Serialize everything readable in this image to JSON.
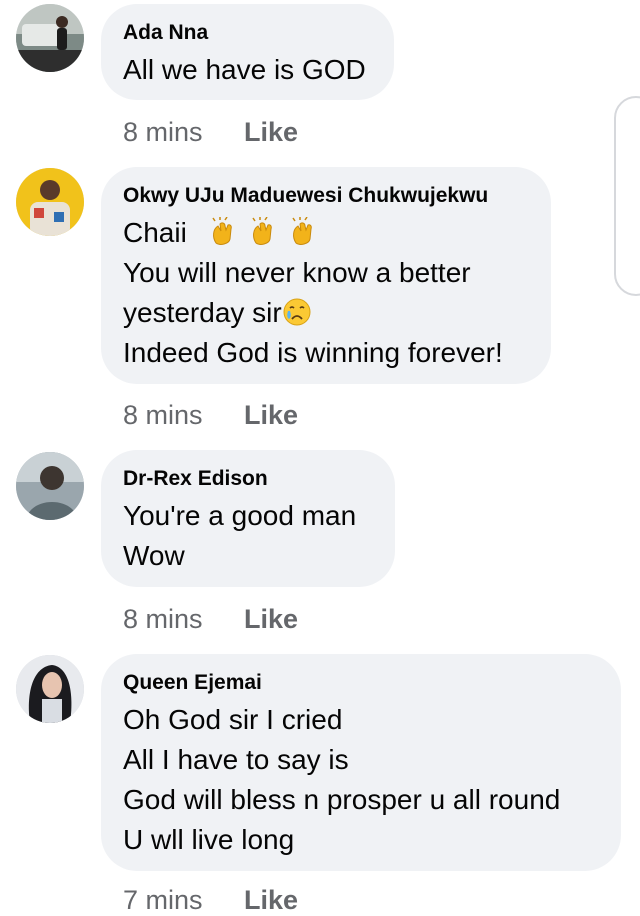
{
  "comments": [
    {
      "author": "Ada Nna",
      "lines": [
        "All we have is GOD"
      ],
      "time": "8 mins",
      "like_label": "Like"
    },
    {
      "author": "Okwy UJu Maduewesi Chukwujekwu",
      "lines": [
        "Chaii",
        "You will never know a better",
        "yesterday sir",
        "Indeed God is winning forever!"
      ],
      "emojis": [
        "clapping-hands",
        "clapping-hands",
        "clapping-hands",
        "crying-face"
      ],
      "time": "8 mins",
      "like_label": "Like"
    },
    {
      "author": "Dr-Rex Edison",
      "lines": [
        "You're a good man",
        "Wow"
      ],
      "time": "8 mins",
      "like_label": "Like"
    },
    {
      "author": "Queen Ejemai",
      "lines": [
        "Oh God sir I cried",
        "All I have to say is",
        "God will bless n prosper u all round",
        "U wll live long"
      ],
      "time": "7 mins",
      "like_label": "Like"
    }
  ],
  "colors": {
    "bubble": "#f0f2f5",
    "meta_text": "#65676b",
    "body_text": "#050505"
  }
}
